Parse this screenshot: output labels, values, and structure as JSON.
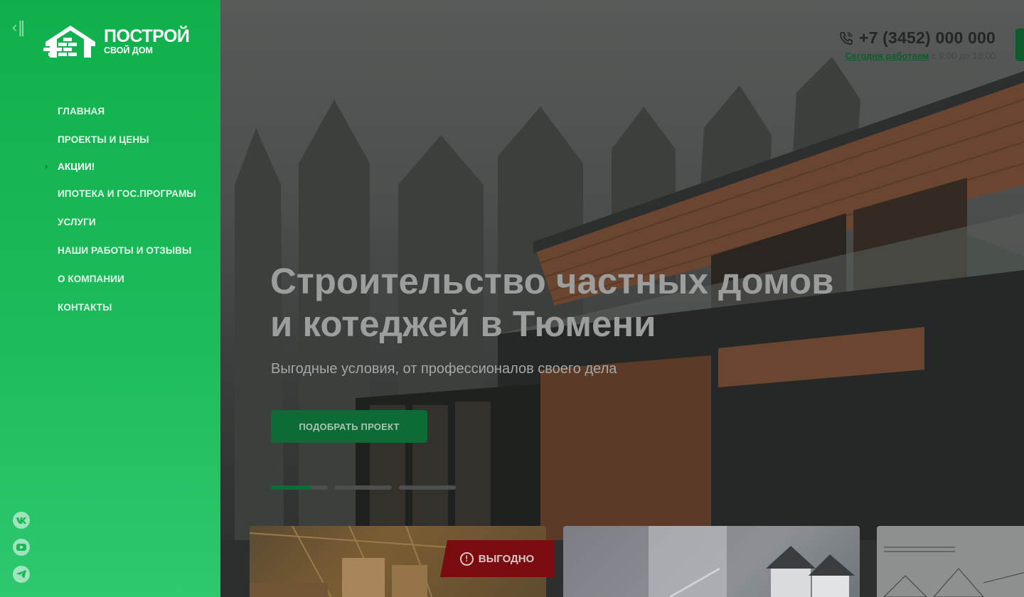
{
  "brand": {
    "logo_main": "ПОСТРОЙ",
    "logo_sub": "СВОЙ ДОМ",
    "accent_color": "#1cb758",
    "dark_accent": "#0e6b35",
    "badge_color": "#7a0b0e"
  },
  "sidebar": {
    "collapse_icon": "collapse-left-icon",
    "items": [
      {
        "label": "ГЛАВНАЯ"
      },
      {
        "label": "ПРОЕКТЫ И ЦЕНЫ"
      },
      {
        "label": "АКЦИИ!",
        "active": true
      },
      {
        "label": "ИПОТЕКА И ГОС.ПРОГРАМЫ"
      },
      {
        "label": "УСЛУГИ"
      },
      {
        "label": "НАШИ РАБОТЫ И ОТЗЫВЫ"
      },
      {
        "label": "О КОМПАНИИ"
      },
      {
        "label": "КОНТАКТЫ"
      }
    ],
    "socials": [
      "vk-icon",
      "youtube-icon",
      "telegram-icon"
    ]
  },
  "contact": {
    "phone": "+7 (3452) 000 000",
    "hours_link": "Сегодня работаем",
    "hours_text": "с 9:00 до 18:00"
  },
  "hero": {
    "title": "Строительство частных домов и котеджей в Тюмени",
    "subtitle": "Выгодные условия, от профессионалов своего дела",
    "cta": "ПОДОБРАТЬ ПРОЕКТ",
    "slides_total": 3,
    "active_slide": 1,
    "active_progress": 0.7
  },
  "cards": {
    "badge": "ВЫГОДНО"
  }
}
